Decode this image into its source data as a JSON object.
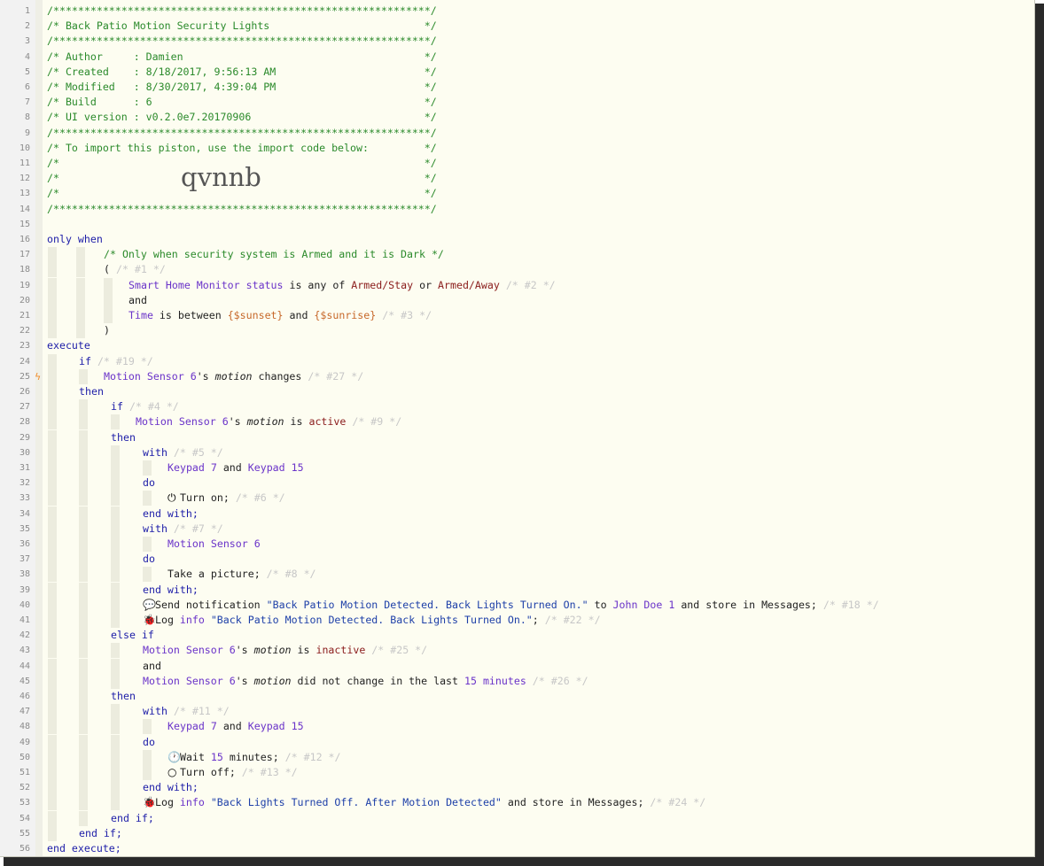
{
  "import_code": "qvnnb",
  "header_lines": {
    "l1": "/*************************************************************/",
    "l2": "/* Back Patio Motion Security Lights                         */",
    "l3": "/*************************************************************/",
    "l4": "/* Author     : Damien                                       */",
    "l5": "/* Created    : 8/18/2017, 9:56:13 AM                        */",
    "l6": "/* Modified   : 8/30/2017, 4:39:04 PM                        */",
    "l7": "/* Build      : 6                                            */",
    "l8": "/* UI version : v0.2.0e7.20170906                            */",
    "l9": "/*************************************************************/",
    "l10": "/* To import this piston, use the import code below:         */",
    "l11": "/*                                                           */",
    "l12": "/*                                                           */",
    "l13": "/*                                                           */",
    "l14": "/*************************************************************/"
  },
  "line_numbers": [
    "1",
    "2",
    "3",
    "4",
    "5",
    "6",
    "7",
    "8",
    "9",
    "10",
    "11",
    "12",
    "13",
    "14",
    "15",
    "16",
    "17",
    "18",
    "19",
    "20",
    "21",
    "22",
    "23",
    "24",
    "25",
    "26",
    "27",
    "28",
    "29",
    "30",
    "31",
    "32",
    "33",
    "34",
    "35",
    "36",
    "37",
    "38",
    "39",
    "40",
    "41",
    "42",
    "43",
    "44",
    "45",
    "46",
    "47",
    "48",
    "49",
    "50",
    "51",
    "52",
    "53",
    "54",
    "55",
    "56"
  ],
  "code": {
    "only_when": "only when",
    "cmt17": "/* Only when security system is Armed and it is Dark */",
    "open_paren": "( ",
    "c1": "/* #1 */",
    "shm": "Smart Home Monitor status",
    "is_any_of": " is any of ",
    "armed_stay": "Armed/Stay",
    "or": " or ",
    "armed_away": "Armed/Away",
    "c2": " /* #2 */",
    "and": "and",
    "time": "Time",
    "is_between": " is between ",
    "sunset": "{$sunset}",
    "and_sp": " and ",
    "sunrise": "{$sunrise}",
    "c3": " /* #3 */",
    "close_paren": ")",
    "execute": "execute",
    "if": "if",
    "c19": " /* #19 */",
    "ms6": "Motion Sensor 6",
    "apos_s": "'s ",
    "motion": "motion",
    "changes": " changes",
    "c27": " /* #27 */",
    "then": "then",
    "c4": " /* #4 */",
    "is_sp": " is ",
    "active": "active",
    "c9": " /* #9 */",
    "with": "with",
    "c5": " /* #5 */",
    "keypad7": "Keypad 7",
    "keypad15": "Keypad 15",
    "do": "do",
    "turn_on": "Turn on;",
    "c6": " /* #6 */",
    "end_with": "end with;",
    "c7": " /* #7 */",
    "take_picture": "Take a picture;",
    "c8": " /* #8 */",
    "send_notification": "Send notification ",
    "msg_on": "\"Back Patio Motion Detected. Back Lights Turned On.\"",
    "to": " to ",
    "john": "John Doe 1",
    "store_in_messages": " and store in Messages;",
    "c18": " /* #18 */",
    "log": "Log ",
    "info": "info",
    "semi": ";",
    "c22": " /* #22 */",
    "else_if": "else if",
    "inactive": "inactive",
    "c25": " /* #25 */",
    "did_not_change": " did not change in the last ",
    "fifteen": "15",
    "minutes": " minutes",
    "c26": " /* #26 */",
    "c11": " /* #11 */",
    "wait": "Wait ",
    "minutes_semi": " minutes;",
    "c12": " /* #12 */",
    "turn_off": "Turn off;",
    "c13": " /* #13 */",
    "msg_off": "\"Back Lights Turned Off. After Motion Detected\"",
    "c24": " /* #24 */",
    "end_if": "end if;",
    "end_execute": "end execute;"
  },
  "icons": {
    "power": "power-icon",
    "chat": "chat-bubble-icon",
    "bug": "bug-icon",
    "clock": "clock-icon",
    "circle": "power-off-icon",
    "flash": "flash-icon"
  }
}
